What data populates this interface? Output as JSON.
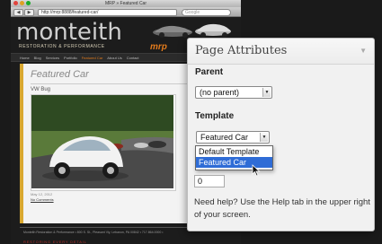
{
  "browser": {
    "window_title": "MRP » Featured Car",
    "url": "http://mrp:8888/featured-car/",
    "search_placeholder": "Google"
  },
  "site": {
    "logo_text": "monteith",
    "tagline": "RESTORATION & PERFORMANCE",
    "brand_mark": "mrp",
    "nav_items": [
      "Home",
      "Blog",
      "Services",
      "Portfolio",
      "Featured Car",
      "About Us",
      "Contact"
    ],
    "active_nav": "Featured Car",
    "page_heading": "Featured Car",
    "post_title": "VW Bug",
    "post_date": "May 12, 2012",
    "comments_link": "No Comments",
    "footer_text": "Monteith Restoration & Performance • 800 S. St., Pleasant Vly, Lebanon, PA 00842 • 717.864.0000 • ",
    "footer_tagline": "RESTORING EVERY DETAIL"
  },
  "panel": {
    "title": "Page Attributes",
    "parent_label": "Parent",
    "parent_value": "(no parent)",
    "template_label": "Template",
    "template_value": "Featured Car",
    "template_options": [
      "Default Template",
      "Featured Car"
    ],
    "selected_option": "Featured Car",
    "order_value": "0",
    "help_text": "Need help? Use the Help tab in the upper right of your screen."
  },
  "colors": {
    "accent_orange": "#e07a1c",
    "selection_blue": "#2f6cd6",
    "sidebar_gold": "#d9a830"
  },
  "icons": {
    "panel_toggle": "triangle-down-icon",
    "select_arrow": "chevron-down-icon",
    "cursor": "mouse-pointer-icon"
  }
}
